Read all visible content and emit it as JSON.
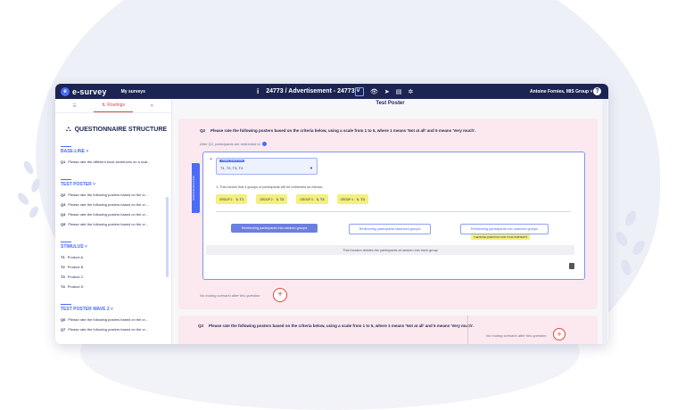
{
  "app": {
    "logo_glyph": "e",
    "name": "e-survey",
    "nav_my_surveys": "My surveys",
    "info_glyph": "i",
    "survey_title": "24773 / Advertisement - 24773 ˅",
    "user": "Antoine Fornies, MIS Group ˅",
    "help": "?",
    "toolbar_icons": [
      "edit-icon",
      "eye-icon",
      "send-icon",
      "chart-icon",
      "settings-icon"
    ]
  },
  "sidebar": {
    "tabs": [
      "☰",
      "Routings",
      "✕"
    ],
    "title": "QUESTIONNAIRE STRUCTURE",
    "sections": [
      {
        "name": "BASE-LINE ˅",
        "items": [
          {
            "id": "Q1",
            "text": "Please rate the different book sentences on a scal..."
          }
        ]
      },
      {
        "name": "TEST POSTER ˅",
        "items": [
          {
            "id": "Q2",
            "text": "Please rate the following posters based on the cr..."
          },
          {
            "id": "Q3",
            "text": "Please rate the following posters based on the cr..."
          },
          {
            "id": "Q4",
            "text": "Please rate the following posters based on the cr..."
          },
          {
            "id": "Q5",
            "text": "Please rate the following posters based on the cr..."
          }
        ]
      },
      {
        "name": "STIMULUS ˅",
        "items": [
          {
            "id": "T1",
            "text": "Product A"
          },
          {
            "id": "T2",
            "text": "Product B"
          },
          {
            "id": "T3",
            "text": "Product C"
          },
          {
            "id": "T4",
            "text": "Product D"
          }
        ]
      },
      {
        "name": "TEST POSTER WAVE 2 ˅",
        "items": [
          {
            "id": "Q6",
            "text": "Please rate the following posters based on the cr..."
          },
          {
            "id": "Q7",
            "text": "Please rate the following posters based on the cr..."
          }
        ]
      }
    ]
  },
  "main": {
    "page_title": "Test Poster",
    "q2": {
      "number": "Q2",
      "text": "Please rate the following posters based on the criteria below, using a scale from 1 to 5, where 1 means 'Not at all' and 5 means 'Very much'.",
      "after_text": "After Q2, participants are redirected to",
      "vertical_tag": "RANDOM ROUTING",
      "select_label": "LINKED QUESTIONS",
      "select_value": "T1, T2, T3, T4",
      "groups_note": "↳ This means that 4 groups of participants will be redirected as follows:",
      "groups": [
        {
          "label": "GROUP 1 :",
          "target": "↳ T1"
        },
        {
          "label": "GROUP 2 :",
          "target": "↳ T2"
        },
        {
          "label": "GROUP 3 :",
          "target": "↳ T3"
        },
        {
          "label": "GROUP 4 :",
          "target": "↳ T4"
        }
      ],
      "btn_random": "Redirecting participants into random groups",
      "btn_balanced": "Redirecting participants balanced groups",
      "btn_matched": "Redirecting participants into matched groups",
      "matched_warning": "THE BASE QUESTION FOR YOUR SUBTESTS",
      "info_bar": "This function divides the participants at random into each group",
      "no_routing": "No routing scenario after this question"
    },
    "q3": {
      "number": "Q3",
      "text": "Please rate the following posters based on the criteria below, using a scale from 1 to 5, where 1 means 'Not at all' and 5 means 'Very much'.",
      "no_routing": "No routing scenario after this question"
    }
  },
  "colors": {
    "navy": "#1c2452",
    "accent": "#4a6cf7",
    "red": "#e0473e",
    "pink": "#fbe9ef",
    "yellow": "#f4f07a"
  }
}
